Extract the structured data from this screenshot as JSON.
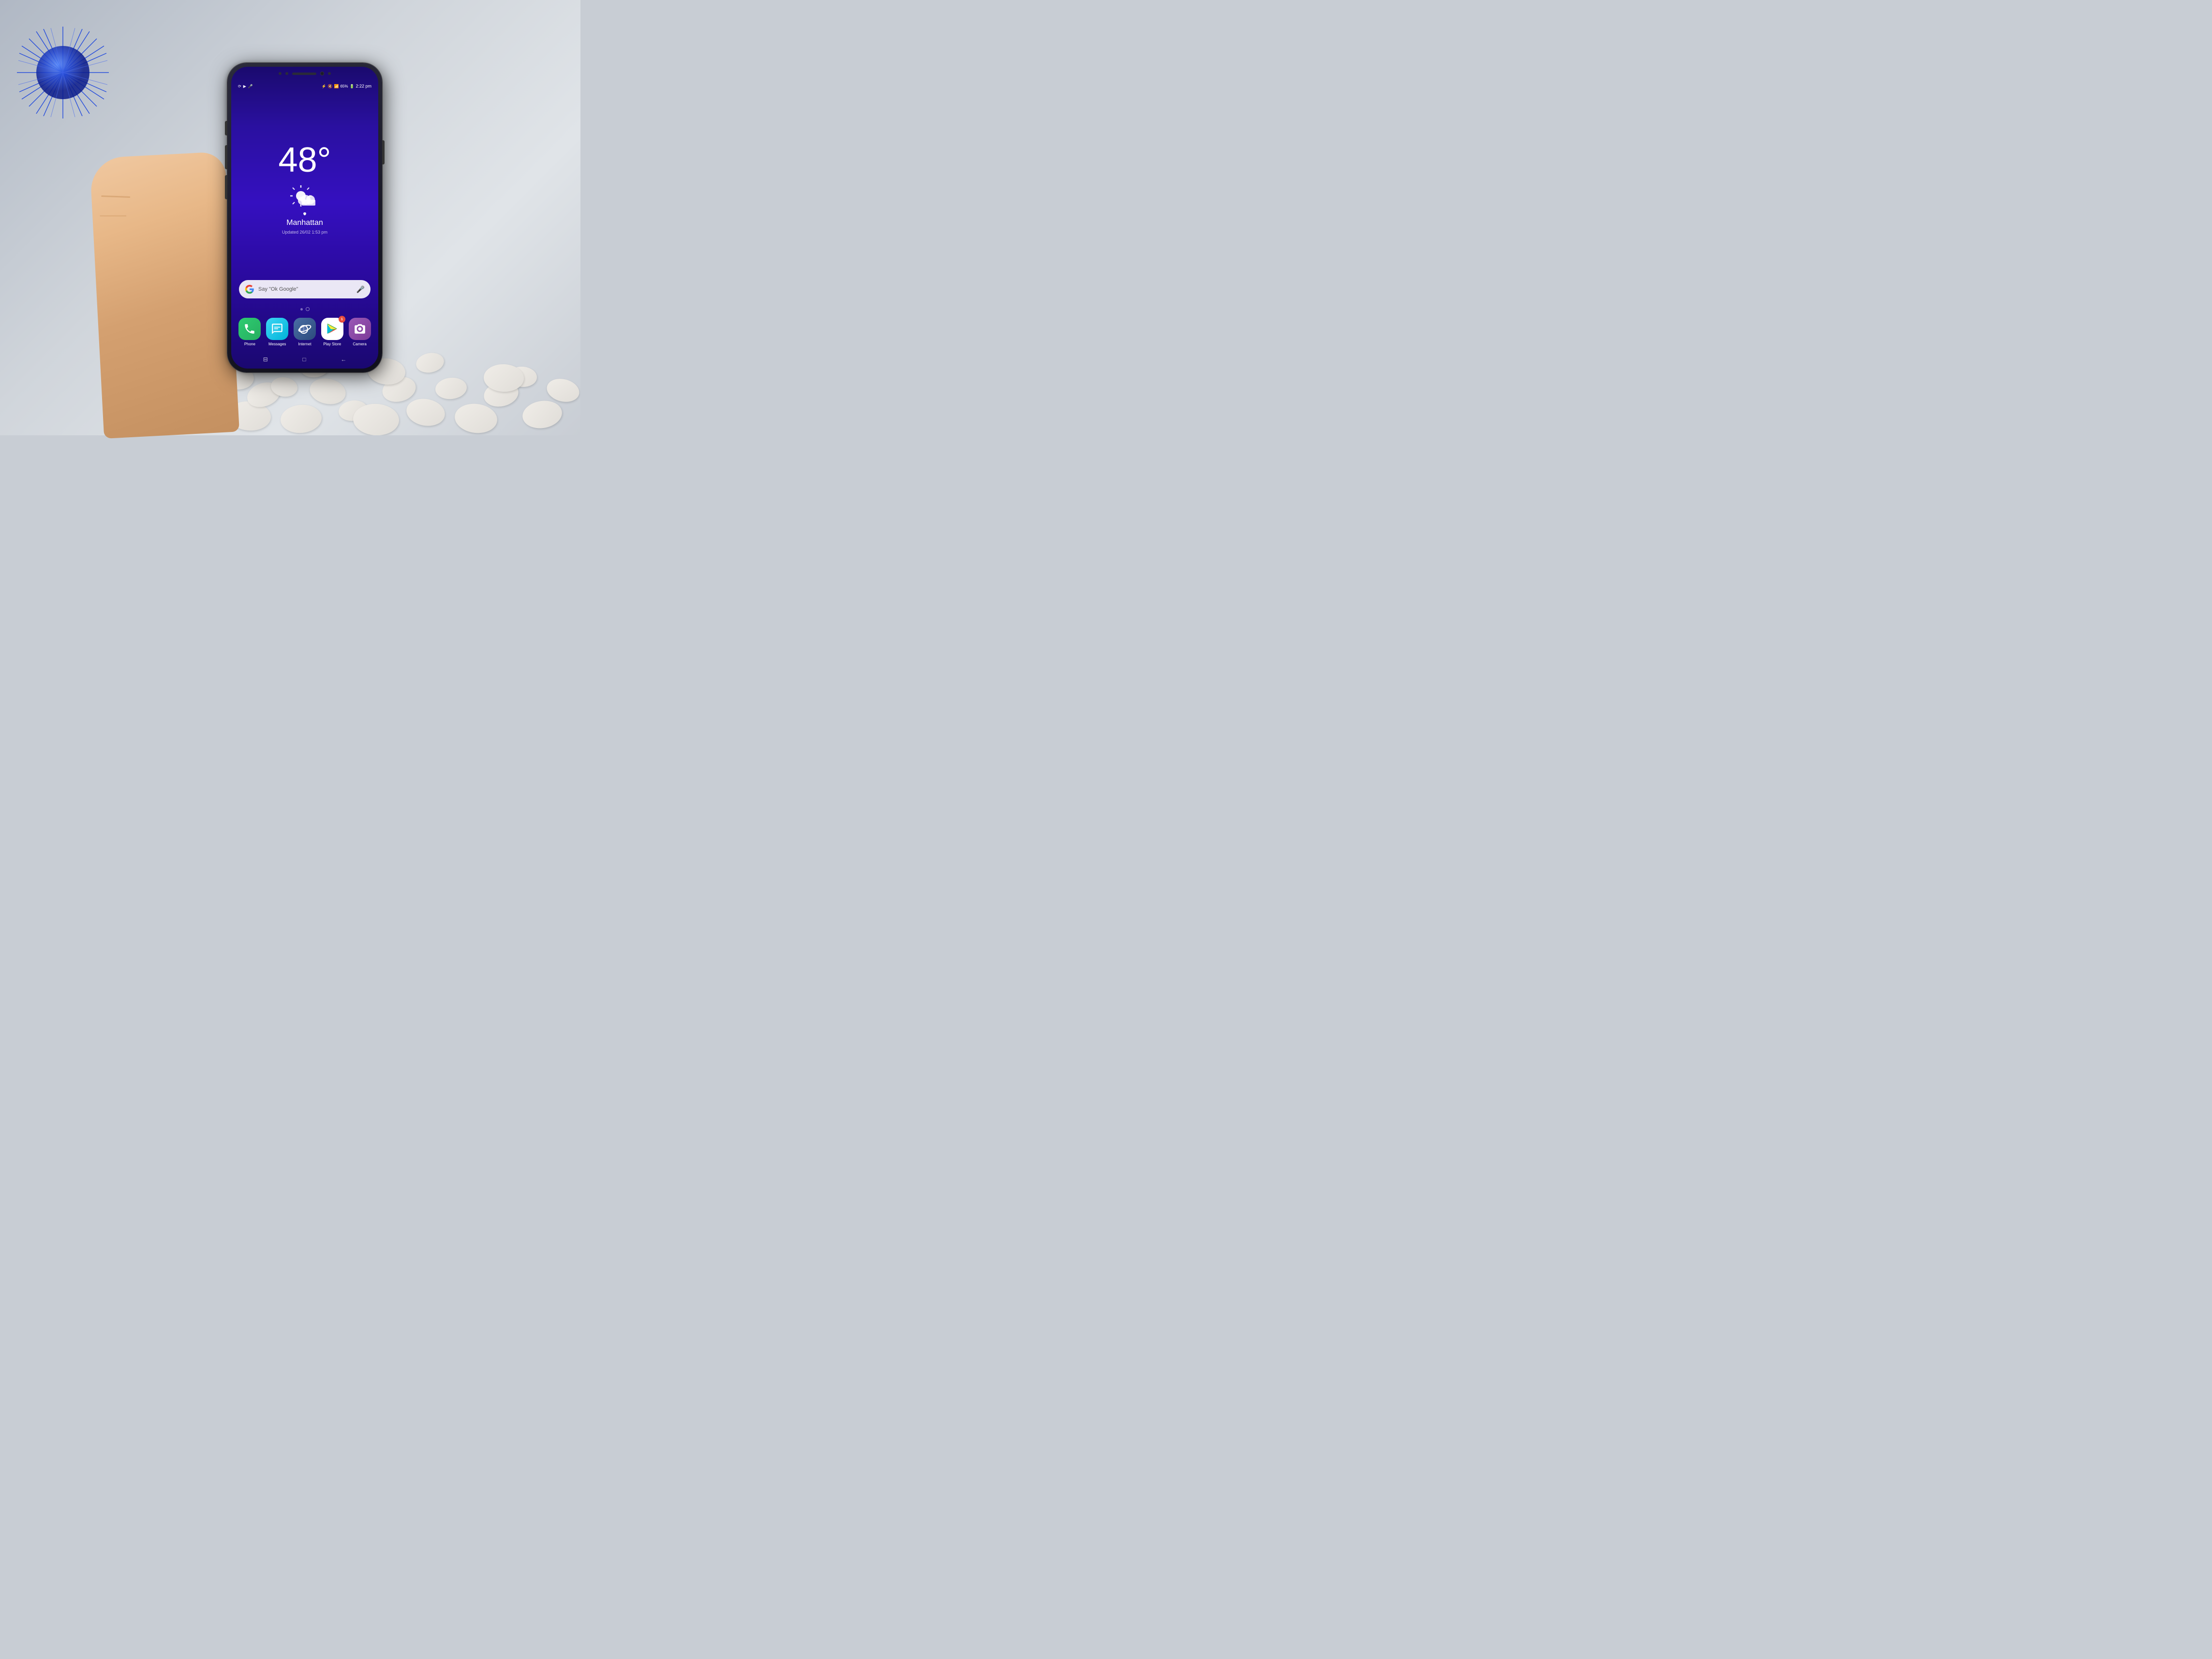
{
  "background": {
    "color": "#c8cdd4"
  },
  "phone": {
    "status_bar": {
      "time": "2:22 pm",
      "battery_percent": "65%",
      "icons_left": [
        "screen-rotation",
        "play",
        "mic"
      ],
      "icons_right": [
        "bluetooth",
        "mute",
        "wifi",
        "signal",
        "battery",
        "time"
      ]
    },
    "weather": {
      "temperature": "48°",
      "weather_icon": "partly-cloudy",
      "location_pin": "📍",
      "city": "Manhattan",
      "updated_label": "Updated 26/02 1:53 pm"
    },
    "search_bar": {
      "google_logo": "G",
      "placeholder": "Say \"Ok Google\"",
      "mic_icon": "🎤"
    },
    "dock": {
      "apps": [
        {
          "name": "Phone",
          "icon": "phone",
          "color_start": "#2ecc71",
          "color_end": "#27ae60",
          "badge": null
        },
        {
          "name": "Messages",
          "icon": "messages",
          "color_start": "#3dd6f5",
          "color_end": "#00b4d8",
          "badge": null
        },
        {
          "name": "Internet",
          "icon": "internet",
          "color_start": "#4a6fa5",
          "color_end": "#2c4a7c",
          "badge": null
        },
        {
          "name": "Play Store",
          "icon": "playstore",
          "color_start": "#ffffff",
          "color_end": "#ffffff",
          "badge": "1"
        },
        {
          "name": "Camera",
          "icon": "camera",
          "color_start": "#9b59b6",
          "color_end": "#7d3c98",
          "badge": null
        }
      ]
    },
    "bottom_nav": {
      "back_icon": "←",
      "home_icon": "□",
      "recents_icon": "⊟"
    }
  }
}
